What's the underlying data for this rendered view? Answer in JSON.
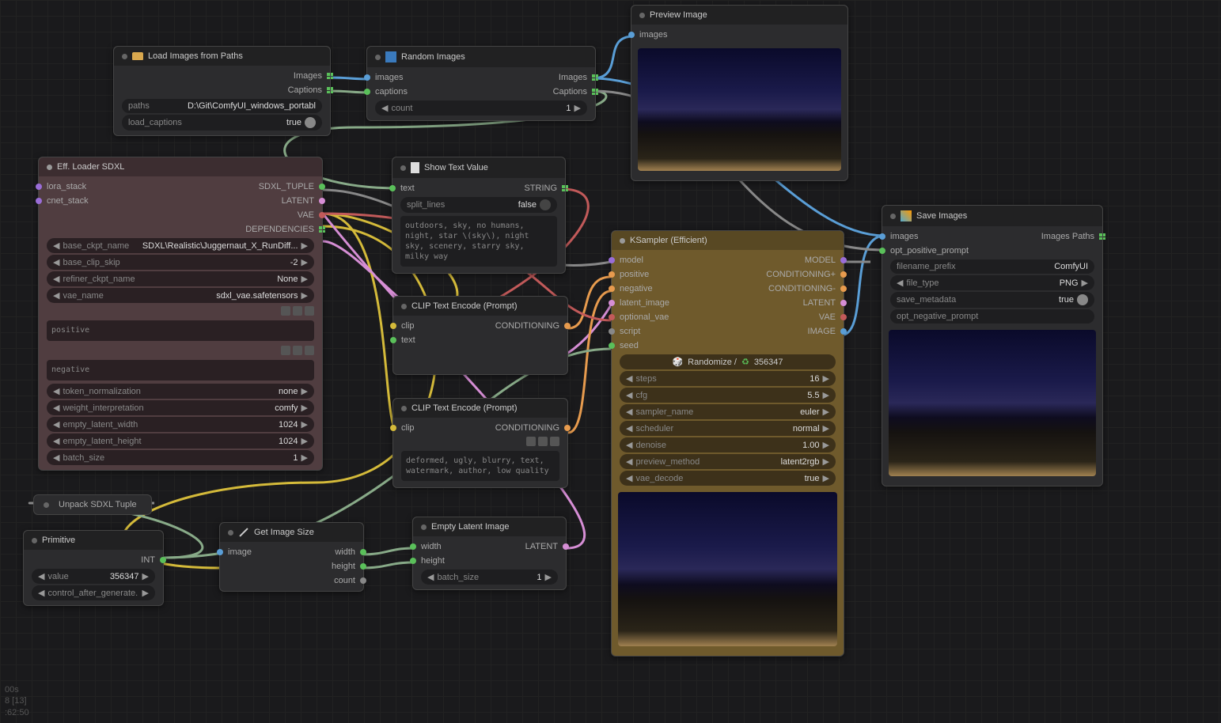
{
  "nodes": {
    "loadImages": {
      "title": "Load Images from Paths",
      "outImages": "Images",
      "outCaptions": "Captions",
      "paths": {
        "name": "paths",
        "val": "D:\\Git\\ComfyUI_windows_portabl"
      },
      "loadCaptions": {
        "name": "load_captions",
        "val": "true"
      }
    },
    "randomImages": {
      "title": "Random Images",
      "inImages": "images",
      "inCaptions": "captions",
      "outImages": "Images",
      "outCaptions": "Captions",
      "count": {
        "name": "count",
        "val": "1"
      }
    },
    "preview": {
      "title": "Preview Image",
      "inImages": "images"
    },
    "effLoader": {
      "title": "Eff. Loader SDXL",
      "inLora": "lora_stack",
      "inCnet": "cnet_stack",
      "outTuple": "SDXL_TUPLE",
      "outLatent": "LATENT",
      "outVae": "VAE",
      "outDeps": "DEPENDENCIES",
      "base": {
        "name": "base_ckpt_name",
        "val": "SDXL\\Realistic\\Juggernaut_X_RunDiff..."
      },
      "clipSkip": {
        "name": "base_clip_skip",
        "val": "-2"
      },
      "refiner": {
        "name": "refiner_ckpt_name",
        "val": "None"
      },
      "vae": {
        "name": "vae_name",
        "val": "sdxl_vae.safetensors"
      },
      "posLabel": "positive",
      "negLabel": "negative",
      "tokenNorm": {
        "name": "token_normalization",
        "val": "none"
      },
      "weight": {
        "name": "weight_interpretation",
        "val": "comfy"
      },
      "width": {
        "name": "empty_latent_width",
        "val": "1024"
      },
      "height": {
        "name": "empty_latent_height",
        "val": "1024"
      },
      "batch": {
        "name": "batch_size",
        "val": "1"
      }
    },
    "showText": {
      "title": "Show Text Value",
      "inText": "text",
      "outString": "STRING",
      "split": {
        "name": "split_lines",
        "val": "false"
      },
      "content": "outdoors, sky, no humans, night, star \\(sky\\), night sky, scenery, starry sky, milky way"
    },
    "clip1": {
      "title": "CLIP Text Encode (Prompt)",
      "inClip": "clip",
      "inText": "text",
      "outCond": "CONDITIONING"
    },
    "clip2": {
      "title": "CLIP Text Encode (Prompt)",
      "inClip": "clip",
      "outCond": "CONDITIONING",
      "content": "deformed, ugly, blurry, text, watermark, author, low quality"
    },
    "ksampler": {
      "title": "KSampler (Efficient)",
      "inModel": "model",
      "inPos": "positive",
      "inNeg": "negative",
      "inLatent": "latent_image",
      "inVae": "optional_vae",
      "inScript": "script",
      "inSeed": "seed",
      "outModel": "MODEL",
      "outCondP": "CONDITIONING+",
      "outCondN": "CONDITIONING-",
      "outLatent": "LATENT",
      "outVae": "VAE",
      "outImage": "IMAGE",
      "seedControl": "Randomize /",
      "seedVal": "356347",
      "steps": {
        "name": "steps",
        "val": "16"
      },
      "cfg": {
        "name": "cfg",
        "val": "5.5"
      },
      "sampler": {
        "name": "sampler_name",
        "val": "euler"
      },
      "scheduler": {
        "name": "scheduler",
        "val": "normal"
      },
      "denoise": {
        "name": "denoise",
        "val": "1.00"
      },
      "previewMethod": {
        "name": "preview_method",
        "val": "latent2rgb"
      },
      "vaeDecode": {
        "name": "vae_decode",
        "val": "true"
      }
    },
    "saveImages": {
      "title": "Save Images",
      "inImages": "images",
      "inPrompt": "opt_positive_prompt",
      "outPaths": "Images Paths",
      "prefix": {
        "name": "filename_prefix",
        "val": "ComfyUI"
      },
      "fileType": {
        "name": "file_type",
        "val": "PNG"
      },
      "metadata": {
        "name": "save_metadata",
        "val": "true"
      },
      "negPrompt": {
        "name": "opt_negative_prompt",
        "val": ""
      }
    },
    "unpack": {
      "title": "Unpack SDXL Tuple"
    },
    "primitive": {
      "title": "Primitive",
      "outInt": "INT",
      "value": {
        "name": "value",
        "val": "356347"
      },
      "control": {
        "name": "control_after_generate.",
        "val": ""
      }
    },
    "getSize": {
      "title": "Get Image Size",
      "inImage": "image",
      "outWidth": "width",
      "outHeight": "height",
      "outCount": "count"
    },
    "emptyLatent": {
      "title": "Empty Latent Image",
      "inWidth": "width",
      "inHeight": "height",
      "outLatent": "LATENT",
      "batch": {
        "name": "batch_size",
        "val": "1"
      }
    }
  },
  "status": {
    "line1": "00s",
    "line2": "8 [13]",
    "line3": ":62:50"
  },
  "colors": {
    "blue": "#5a9ed6",
    "green": "#5ac05a",
    "yellow": "#d4ba3a",
    "orange": "#e79b4e",
    "pink": "#d68ed5",
    "red": "#c25a5a",
    "purple": "#9a6dd7",
    "grey": "#888"
  }
}
